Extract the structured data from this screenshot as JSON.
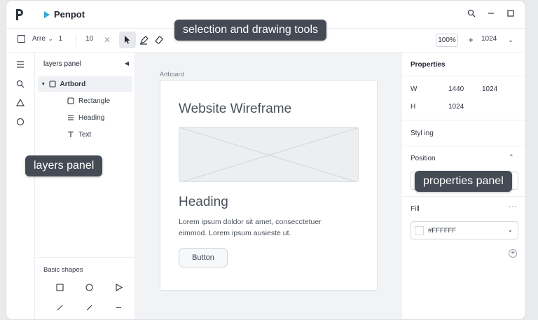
{
  "app": {
    "name": "Penpot",
    "accent": "#31a8d6"
  },
  "toolbar": {
    "board_label": "Arre",
    "board_count": "1",
    "size_value": "10",
    "zoom": "100%",
    "width_value": "1024"
  },
  "layers": {
    "header": "layers panel",
    "items": [
      {
        "label": "Artbord",
        "icon": "board-icon"
      },
      {
        "label": "Rectangle",
        "icon": "rectangle-icon"
      },
      {
        "label": "Heading",
        "icon": "text-lines-icon"
      },
      {
        "label": "Text",
        "icon": "text-t-icon"
      }
    ],
    "shapes_title": "Basic shapes"
  },
  "canvas": {
    "artboard_label": "Artboard",
    "wireframe_title": "Website Wireframe",
    "heading": "Heading",
    "body": "Lorem ipsum doldor sit amet, consecctetuer eimmod. Lorem ipsum ausieste ut.",
    "button": "Button"
  },
  "properties": {
    "title": "Properties",
    "w_label": "W",
    "w_value1": "1440",
    "w_value2": "1024",
    "h_label": "H",
    "h_value": "1024",
    "styling": "Styl ing",
    "position": "Position",
    "fill": "Fill",
    "fill_value": "#FFFFFF"
  },
  "callouts": {
    "tools": "selection and drawing tools",
    "layers": "layers panel",
    "properties": "properties panel"
  }
}
